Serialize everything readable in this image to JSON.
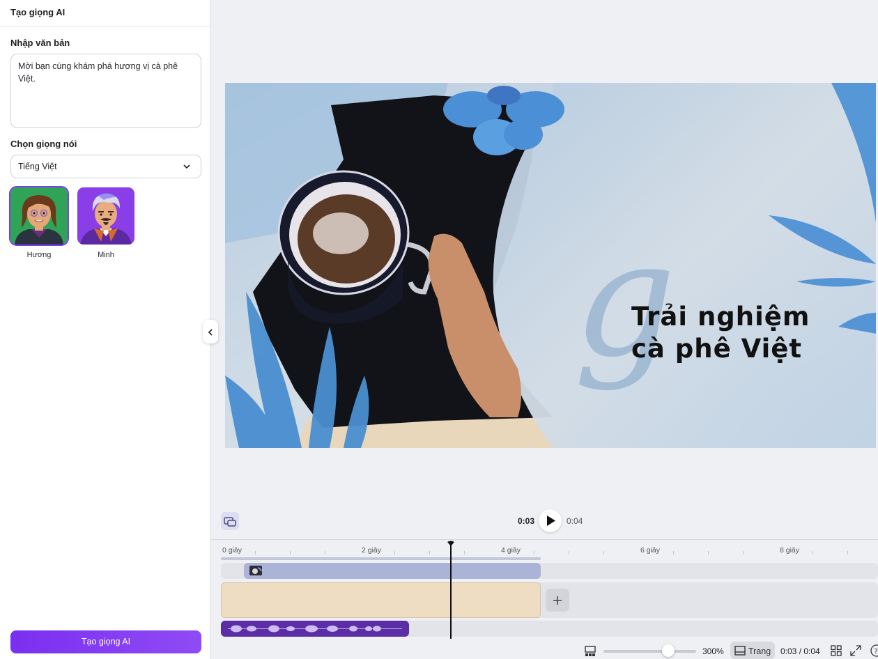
{
  "panel": {
    "title": "Tạo giọng AI",
    "text_label": "Nhập văn bản",
    "text_value": "Mời bạn cùng khám phá hương vị cà phê Việt.",
    "voice_label": "Chọn giọng nói",
    "language_value": "Tiếng Việt",
    "voices": [
      {
        "name": "Hương",
        "selected": true
      },
      {
        "name": "Minh",
        "selected": false
      }
    ],
    "generate_button": "Tạo giọng AI"
  },
  "canvas": {
    "title_line1": "Trải nghiệm",
    "title_line2": "cà phê Việt"
  },
  "playback": {
    "current_time": "0:03",
    "duration": "0:04"
  },
  "timeline": {
    "ticks": [
      "0 giây",
      "2 giây",
      "4 giây",
      "6 giây",
      "8 giây"
    ]
  },
  "bottom_bar": {
    "zoom": "300%",
    "page_label": "Trang",
    "time_readout": "0:03 / 0:04"
  },
  "colors": {
    "accent": "#7d3cf2",
    "audio_clip": "#5b2ea6",
    "video_clip": "#abb3d6",
    "page_clip": "#eedcc3"
  },
  "icons": [
    "chevron-down-icon",
    "chevron-left-icon",
    "play-icon",
    "add-icon",
    "grid-icon",
    "fullscreen-icon",
    "help-icon",
    "layout-icon",
    "page-icon",
    "clip-link-icon"
  ]
}
